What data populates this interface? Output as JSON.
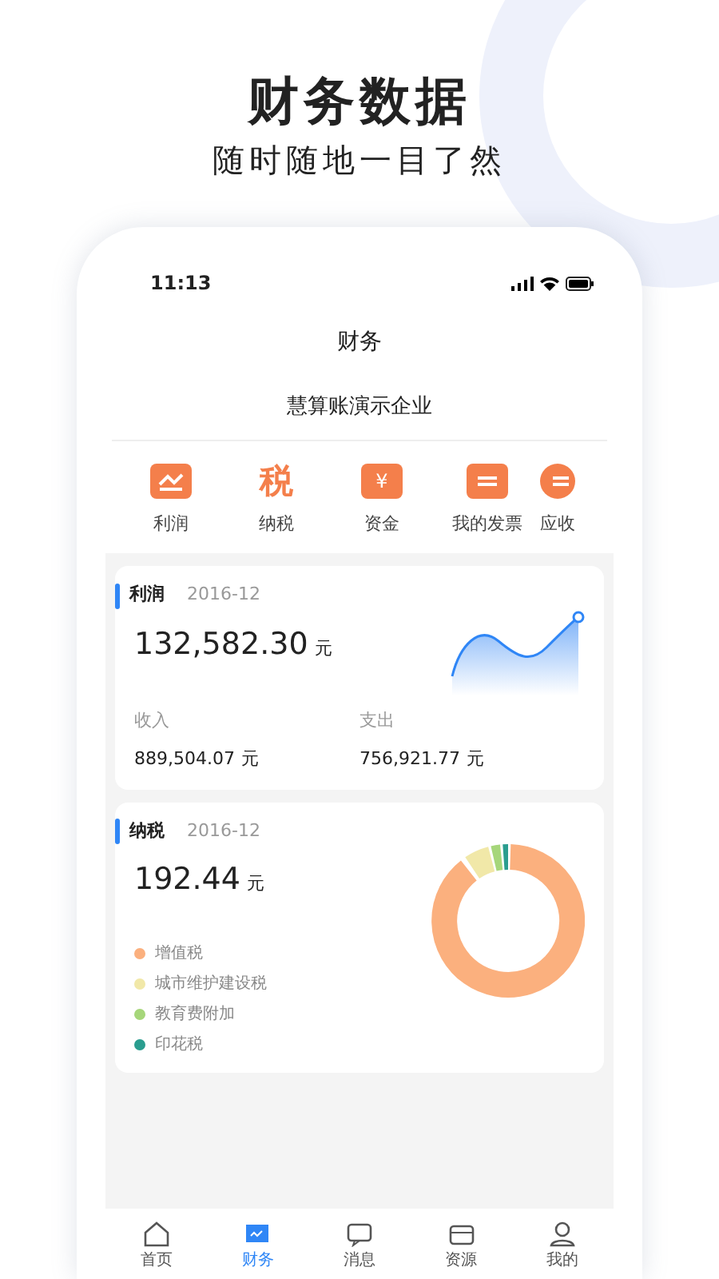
{
  "headline": {
    "title": "财务数据",
    "subtitle": "随时随地一目了然"
  },
  "status_bar": {
    "time": "11:13"
  },
  "nav": {
    "title": "财务"
  },
  "company": "慧算账演示企业",
  "shortcuts": [
    {
      "kind": "chart",
      "label": "利润"
    },
    {
      "kind": "tax",
      "label": "纳税",
      "glyph": "税"
    },
    {
      "kind": "wallet",
      "label": "资金",
      "glyph": "¥"
    },
    {
      "kind": "invoice",
      "label": "我的发票"
    },
    {
      "kind": "receivable",
      "label": "应收"
    }
  ],
  "profit_card": {
    "title": "利润",
    "period": "2016-12",
    "amount": "132,582.30",
    "unit": "元",
    "stats": [
      {
        "label": "收入",
        "amount": "889,504.07",
        "unit": "元"
      },
      {
        "label": "支出",
        "amount": "756,921.77",
        "unit": "元"
      }
    ]
  },
  "tax_card": {
    "title": "纳税",
    "period": "2016-12",
    "amount": "192.44",
    "unit": "元",
    "legend": [
      {
        "label": "增值税",
        "color": "#fbb07e"
      },
      {
        "label": "城市维护建设税",
        "color": "#f1e8a8"
      },
      {
        "label": "教育费附加",
        "color": "#a6d67a"
      },
      {
        "label": "印花税",
        "color": "#2a9d8f"
      }
    ]
  },
  "tab_bar": [
    {
      "kind": "home",
      "label": "首页",
      "selected": false
    },
    {
      "kind": "finance",
      "label": "财务",
      "selected": true
    },
    {
      "kind": "message",
      "label": "消息",
      "selected": false
    },
    {
      "kind": "resource",
      "label": "资源",
      "selected": false
    },
    {
      "kind": "profile",
      "label": "我的",
      "selected": false
    }
  ]
}
